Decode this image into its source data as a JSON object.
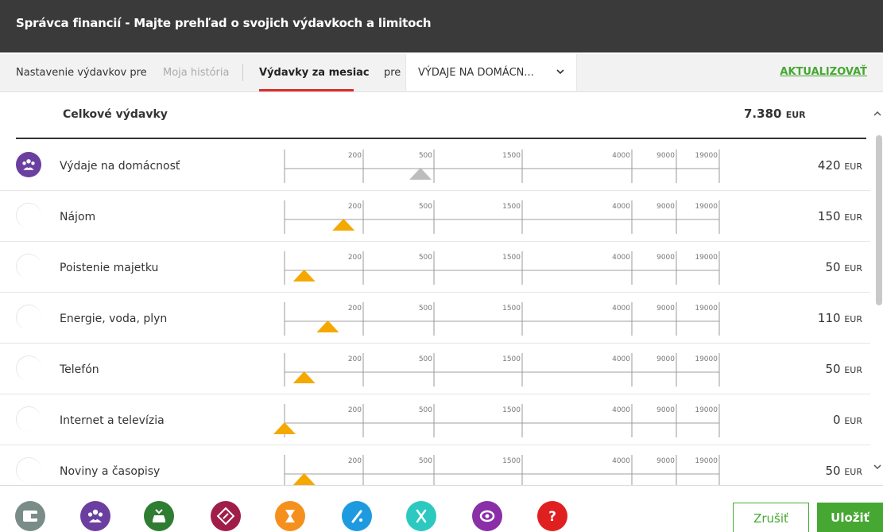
{
  "window": {
    "title": "Správca financií - Majte prehľad o svojich výdavkoch a limitoch"
  },
  "tabs": {
    "settings_label": "Nastavenie výdavkov pre",
    "history_label": "Moja história",
    "monthly_label": "Výdavky za mesiac",
    "for_label": "pre",
    "category_select_value": "VÝDAJE NA DOMÁCN...",
    "update_label": "AKTUALIZOVAŤ"
  },
  "total": {
    "label": "Celkové výdavky",
    "amount": "7.380",
    "currency": "EUR"
  },
  "scale_ticks": [
    "200",
    "500",
    "1500",
    "4000",
    "9000",
    "19000"
  ],
  "rows": [
    {
      "label": "Výdaje na domácnosť",
      "amount": "420",
      "currency": "EUR",
      "value": 420,
      "marker": "gray",
      "icon": "household-icon"
    },
    {
      "label": "Nájom",
      "amount": "150",
      "currency": "EUR",
      "value": 150,
      "marker": "orange",
      "icon": ""
    },
    {
      "label": "Poistenie majetku",
      "amount": "50",
      "currency": "EUR",
      "value": 50,
      "marker": "orange",
      "icon": ""
    },
    {
      "label": "Energie, voda, plyn",
      "amount": "110",
      "currency": "EUR",
      "value": 110,
      "marker": "orange",
      "icon": ""
    },
    {
      "label": "Telefón",
      "amount": "50",
      "currency": "EUR",
      "value": 50,
      "marker": "orange",
      "icon": ""
    },
    {
      "label": "Internet a televízia",
      "amount": "0",
      "currency": "EUR",
      "value": 0,
      "marker": "orange",
      "icon": ""
    },
    {
      "label": "Noviny a časopisy",
      "amount": "50",
      "currency": "EUR",
      "value": 50,
      "marker": "orange",
      "icon": ""
    }
  ],
  "colors": {
    "marker_orange": "#f5a800",
    "marker_gray": "#bdbdbd",
    "accent_green": "#46a832",
    "tab_underline": "#e02c2c"
  },
  "categories": [
    {
      "name": "wallet-icon",
      "color": "#7a8c87"
    },
    {
      "name": "household-icon",
      "color": "#6a3fa0"
    },
    {
      "name": "car-icon",
      "color": "#2e7d32"
    },
    {
      "name": "ticket-icon",
      "color": "#a01d4a"
    },
    {
      "name": "hourglass-icon",
      "color": "#f5901e"
    },
    {
      "name": "health-icon",
      "color": "#1e9be0"
    },
    {
      "name": "leisure-icon",
      "color": "#2cc9c0"
    },
    {
      "name": "money-icon",
      "color": "#8a2fa8"
    },
    {
      "name": "help-icon",
      "color": "#e02020"
    }
  ],
  "footer": {
    "cancel_label": "Zrušiť",
    "save_label": "Uložiť"
  }
}
